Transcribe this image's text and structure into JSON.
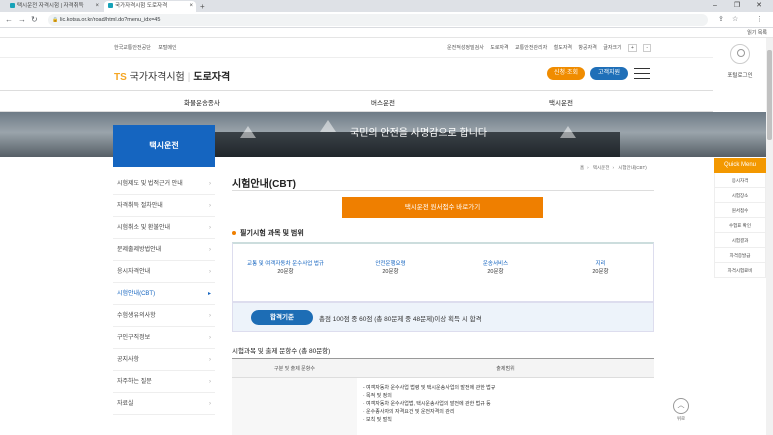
{
  "browser": {
    "tabs": [
      {
        "label": "택시운전 자격시험 | 자격취득"
      },
      {
        "label": "국가자격시험 도로자격"
      }
    ],
    "new_tab": "+",
    "url": "lic.kotsa.or.kr/road/html.do?menu_idx=45",
    "bookmarks_right": "읽기 목록"
  },
  "util": {
    "left": [
      "한국교통안전공단",
      "포털메인"
    ],
    "right": [
      "운전적성정밀검사",
      "도로자격",
      "교통안전관리자",
      "철도자격",
      "항공자격",
      "글자크기"
    ],
    "font_plus": "+",
    "font_minus": "-"
  },
  "header": {
    "logo_ts": "TS",
    "logo_main": "국가자격시험",
    "logo_sub": "도로자격",
    "apply_btn": "신청·조회",
    "support_btn": "고객지원",
    "login_label": "포털로그인"
  },
  "gnb": [
    "화물운송종사",
    "버스운전",
    "택시운전"
  ],
  "banner": {
    "slogan": "국민의 안전을 사명감으로 합니다"
  },
  "lnb": {
    "title": "택시운전",
    "items": [
      {
        "label": "시험제도 및 법적근거 안내"
      },
      {
        "label": "자격취득 절차안내"
      },
      {
        "label": "시험취소 및 환불안내"
      },
      {
        "label": "문제출제방법안내"
      },
      {
        "label": "응시자격안내"
      },
      {
        "label": "시험안내(CBT)"
      },
      {
        "label": "수험생유의사항"
      },
      {
        "label": "구인구직정보"
      },
      {
        "label": "공지사항"
      },
      {
        "label": "자주하는 질문"
      },
      {
        "label": "자료실"
      }
    ],
    "active_index": 5
  },
  "content": {
    "title": "시험안내(CBT)",
    "breadcrumb": [
      "홈",
      "택시운전",
      "시험안내(CBT)"
    ],
    "apply_button": "택시운전 원서접수 바로가기",
    "section1_title": "필기시험 과목 및 범위",
    "subjects": [
      {
        "name": "교통 및 여객자동차 운수사업 법규",
        "count": "20문항"
      },
      {
        "name": "안전운행요령",
        "count": "20문항"
      },
      {
        "name": "운송서비스",
        "count": "20문항"
      },
      {
        "name": "지리",
        "count": "20문항"
      }
    ],
    "criteria_label": "합격기준",
    "criteria_text": "총점 100점 중 60점 (총 80문제 중 48문제)이상 획득 시 합격",
    "section2_title": "시험과목 및 출제 문항수 (총 80문항)",
    "table_headers": [
      "구분 및 출제 문항수",
      "출제범위"
    ],
    "table_items": [
      "- 여객자동차 운수사업 법령 및 택시운송사업의 발전에 관한 법규",
      "· 목적 및 정의",
      "· 여객자동차 운수사업법, 택시운송사업의 발전에 관한 법규 등",
      "· 운수종사자의 자격요건 및 운전자격의 관리",
      "· 보칙 및 벌칙"
    ]
  },
  "quick_menu": {
    "title": "Quick Menu",
    "items": [
      "응시자격",
      "시험장소",
      "원서접수",
      "수험표 확인",
      "시험결과",
      "자격증발급",
      "자격시험료비"
    ]
  },
  "top_button": "위로",
  "colors": {
    "brand_blue": "#1565c0",
    "accent_orange": "#ef7f00",
    "quick_orange": "#f39800"
  }
}
